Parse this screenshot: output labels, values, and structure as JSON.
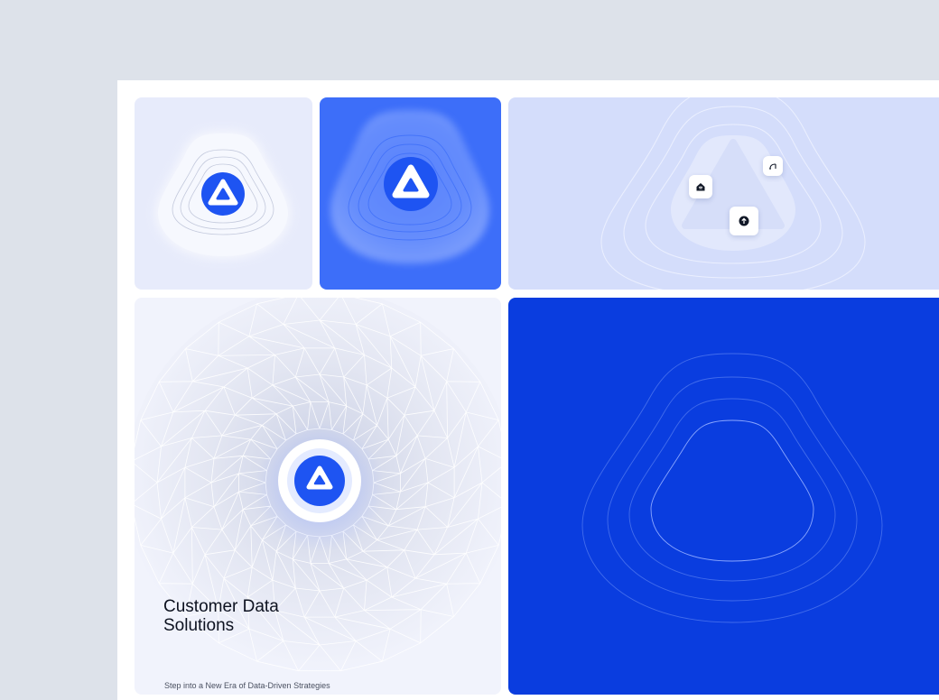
{
  "card": {
    "title_line1": "Customer Data",
    "title_line2": "Solutions",
    "subtitle": "Step into a New Era of Data-Driven Strategies"
  },
  "colors": {
    "page_background": "#dde2ea",
    "tile_light": "#e7ebfb",
    "tile_blue": "#3d6ef9",
    "tile_pale": "#d4ddfb",
    "tile_soft": "#f1f3fc",
    "tile_deep": "#0a3ddf",
    "brand_blue": "#1e54f2"
  },
  "icons": {
    "logo": "rounded-triangle-logo-icon",
    "home": "home-icon",
    "upload": "arrow-up-circle-icon",
    "signal": "signal-arc-icon"
  }
}
